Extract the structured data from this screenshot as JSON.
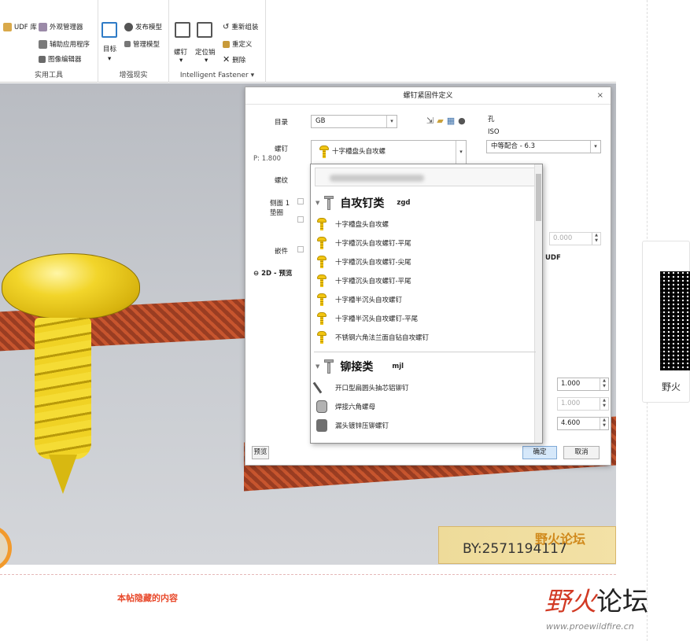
{
  "ribbon": {
    "util": {
      "udf": "UDF 库",
      "appearance": "外观管理器",
      "aux_app": "辅助应用程序",
      "image_editor": "图像编辑器",
      "caption": "实用工具"
    },
    "enhance": {
      "target": "目标",
      "publish": "发布模型",
      "manage": "管理模型",
      "caption": "增强现实"
    },
    "fastener": {
      "screw": "螺钉",
      "dowel": "定位销",
      "reassemble": "重新组装",
      "redefine": "重定义",
      "delete": "删除",
      "caption": "Intelligent Fastener"
    }
  },
  "dialog": {
    "title": "螺钉紧固件定义",
    "close": "×",
    "catalog_label": "目录",
    "catalog_value": "GB",
    "hole_label": "孔",
    "iso_label": "ISO",
    "screw_label": "螺钉",
    "pitch_label": "P: 1.800",
    "screw_value": "十字槽盘头自攻螺",
    "fit_value": "中等配合 - 6.3",
    "thread_label": "螺纹",
    "side1_label": "侧面 1",
    "washer_label": "垫圈",
    "insert_label": "嵌件",
    "preview2d_label": "2D - 预览",
    "udf_label": "UDF",
    "value_a": "0.000",
    "value_b": "1.000",
    "value_c": "1.000",
    "value_d": "4.600",
    "preview_btn": "预览",
    "ok_btn": "确定",
    "cancel_btn": "取消"
  },
  "popup": {
    "cat1": {
      "name": "自攻钉类",
      "code": "zgd"
    },
    "cat1_items": [
      "十字槽盘头自攻螺",
      "十字槽沉头自攻螺钉-平尾",
      "十字槽沉头自攻螺钉-尖尾",
      "十字槽沉头自攻螺钉-平尾",
      "十字槽半沉头自攻螺钉",
      "十字槽半沉头自攻螺钉-平尾",
      "不锈钢六角法兰面自钻自攻螺钉"
    ],
    "cat2": {
      "name": "铆接类",
      "code": "mjl"
    },
    "cat2_items": [
      "开口型扁圆头抽芯铝铆钉",
      "焊接六角螺母",
      "漏头镀锌压铆螺钉"
    ]
  },
  "watermark": {
    "by": "BY:2571194117",
    "brand": "野火论坛"
  },
  "hidden_content": "本帖隐藏的内容",
  "logo": {
    "red": "野火",
    "dark": "论坛",
    "url": "www.proewildfire.cn"
  },
  "qr_label": "野火"
}
